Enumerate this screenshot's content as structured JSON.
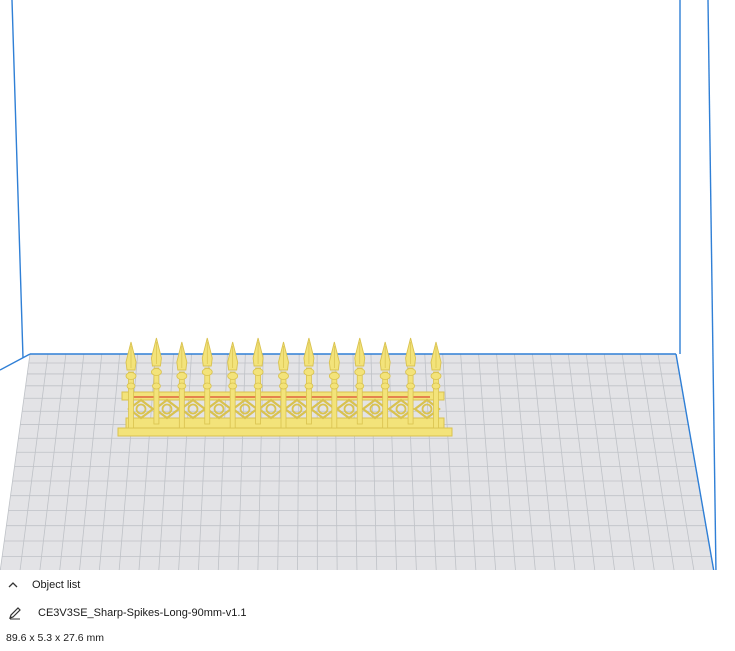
{
  "object_list": {
    "header_label": "Object list",
    "toggle_icon": "chevron-up-icon",
    "edit_icon": "pencil-icon",
    "file_name": "CE3V3SE_Sharp-Spikes-Long-90mm-v1.1",
    "dimensions": "89.6 x 5.3 x 27.6 mm"
  },
  "colors": {
    "build_volume_edge": "#2f7fd6",
    "build_plate": "#e3e3e6",
    "grid_lines": "#bfc2c7",
    "model_fill": "#f3e37a",
    "model_shade": "#d9c24f",
    "model_overhang": "#d9342a"
  }
}
